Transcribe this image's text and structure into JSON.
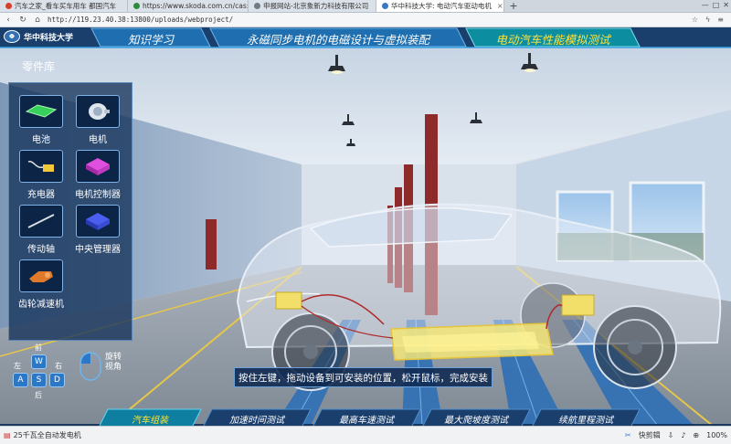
{
  "browser": {
    "tabs": [
      {
        "label": "汽车之家_看车买车用车 都国汽车",
        "color": "#d6402c",
        "active": false
      },
      {
        "label": "https://www.skoda.com.cn/cas:",
        "color": "#2e8b3e",
        "active": false
      },
      {
        "label": "申报网站-北京象新力科技有限公司",
        "color": "#6f7a85",
        "active": false
      },
      {
        "label": "华中科技大学: 电动汽车驱动电机",
        "color": "#3b78c4",
        "active": true
      }
    ],
    "url": "http://119.23.40.38:13800/uploads/webproject/",
    "new_tab": "+",
    "tab_close": "×"
  },
  "app": {
    "logo_text": "华中科技大学",
    "nav": [
      {
        "label": "知识学习",
        "active": false
      },
      {
        "label": "永磁同步电机的电磁设计与虚拟装配",
        "active": false
      },
      {
        "label": "电动汽车性能模拟测试",
        "active": true
      }
    ],
    "library": {
      "title": "零件库",
      "parts": [
        {
          "label": "电池",
          "icon": "battery-icon"
        },
        {
          "label": "电机",
          "icon": "motor-icon"
        },
        {
          "label": "充电器",
          "icon": "charger-icon"
        },
        {
          "label": "电机控制器",
          "icon": "motor-controller-icon"
        },
        {
          "label": "传动轴",
          "icon": "drive-shaft-icon"
        },
        {
          "label": "中央管理器",
          "icon": "central-manager-icon"
        },
        {
          "label": "齿轮减速机",
          "icon": "gear-reducer-icon"
        }
      ]
    },
    "controls": {
      "keys": [
        "W",
        "A",
        "S",
        "D"
      ],
      "front": "前",
      "back": "后",
      "left": "左",
      "right": "右",
      "rotate_line1": "旋转",
      "rotate_line2": "视角"
    },
    "instruction": "按住左键，拖动设备到可安装的位置，松开鼠标，完成安装",
    "bottom_tabs": [
      {
        "label": "汽车组装",
        "active": true
      },
      {
        "label": "加速时间测试",
        "active": false
      },
      {
        "label": "最高车速测试",
        "active": false
      },
      {
        "label": "最大爬坡度测试",
        "active": false
      },
      {
        "label": "续航里程测试",
        "active": false
      }
    ]
  },
  "status": {
    "left_text": "25千瓦全自动发电机",
    "clip_label": "快剪辑",
    "zoom": "100%"
  },
  "colors": {
    "accent_yellow": "#ffe23a",
    "panel_blue": "#143c6e",
    "header_blue": "#1a3f6d"
  }
}
